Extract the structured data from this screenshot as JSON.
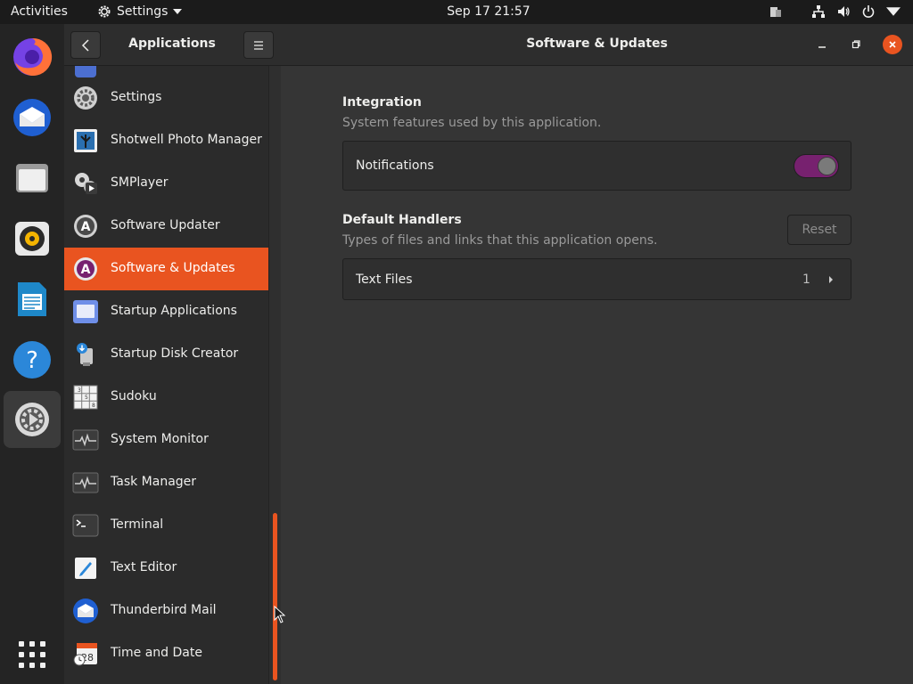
{
  "topbar": {
    "activities": "Activities",
    "app_menu": "Settings",
    "clock": "Sep 17  21:57"
  },
  "dock": {
    "items": [
      {
        "name": "firefox-icon"
      },
      {
        "name": "thunderbird-icon"
      },
      {
        "name": "files-icon"
      },
      {
        "name": "rhythmbox-icon"
      },
      {
        "name": "libreoffice-writer-icon"
      },
      {
        "name": "help-icon"
      },
      {
        "name": "settings-icon"
      },
      {
        "name": "show-apps-icon"
      }
    ]
  },
  "sidebar": {
    "title": "Applications",
    "apps": [
      {
        "label": "Settings",
        "icon": "gear-icon"
      },
      {
        "label": "Shotwell Photo Manager",
        "icon": "photo-icon"
      },
      {
        "label": "SMPlayer",
        "icon": "film-icon"
      },
      {
        "label": "Software Updater",
        "icon": "updater-icon"
      },
      {
        "label": "Software & Updates",
        "icon": "software-icon",
        "selected": true
      },
      {
        "label": "Startup Applications",
        "icon": "startup-icon"
      },
      {
        "label": "Startup Disk Creator",
        "icon": "usb-icon"
      },
      {
        "label": "Sudoku",
        "icon": "sudoku-icon"
      },
      {
        "label": "System Monitor",
        "icon": "monitor-icon"
      },
      {
        "label": "Task Manager",
        "icon": "task-icon"
      },
      {
        "label": "Terminal",
        "icon": "terminal-icon"
      },
      {
        "label": "Text Editor",
        "icon": "text-editor-icon"
      },
      {
        "label": "Thunderbird Mail",
        "icon": "mail-icon"
      },
      {
        "label": "Time and Date",
        "icon": "calendar-icon"
      }
    ]
  },
  "main": {
    "title": "Software & Updates",
    "integration": {
      "title": "Integration",
      "subtitle": "System features used by this application.",
      "notifications_label": "Notifications",
      "notifications_on": true
    },
    "handlers": {
      "title": "Default Handlers",
      "subtitle": "Types of files and links that this application opens.",
      "reset_label": "Reset",
      "text_files_label": "Text Files",
      "text_files_count": "1"
    }
  },
  "colors": {
    "accent": "#e95420",
    "toggle_on": "#77216f"
  }
}
